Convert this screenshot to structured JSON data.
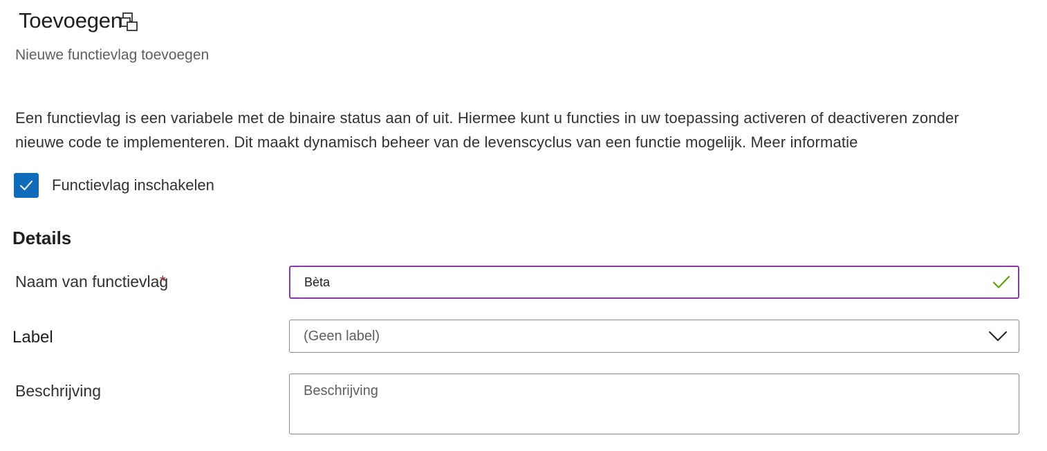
{
  "header": {
    "title": "Toevoegen",
    "subtitle": "Nieuwe functievlag toevoegen"
  },
  "intro": {
    "text": "Een functievlag is een variabele met de binaire status aan of uit. Hiermee kunt u functies in uw toepassing activeren of deactiveren zonder nieuwe code te implementeren. Dit maakt dynamisch beheer van de levenscyclus van een functie mogelijk.",
    "link_label": "Meer informatie"
  },
  "enable_checkbox": {
    "label": "Functievlag inschakelen",
    "checked": true
  },
  "details": {
    "section_title": "Details",
    "name_field": {
      "label": "Naam van functievlag",
      "required_marker": "*",
      "value": "Bèta"
    },
    "label_field": {
      "label": "Label",
      "selected": "(Geen label)"
    },
    "description_field": {
      "label": "Beschrijving",
      "placeholder": "Beschrijving"
    }
  },
  "colors": {
    "accent_blue": "#0f6cbd",
    "focus_border": "#8a3aa8",
    "valid_green": "#57a300",
    "required_red": "#a4262c"
  },
  "icons": {
    "title_icon": "copy-icon",
    "checkbox_icon": "checkmark-icon",
    "valid_icon": "checkmark-icon",
    "dropdown_icon": "chevron-down-icon"
  }
}
